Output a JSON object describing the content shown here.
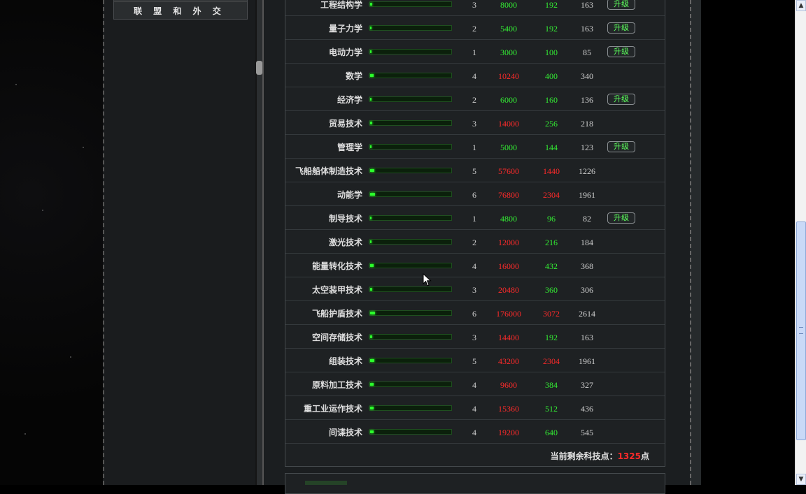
{
  "sidebar": {
    "items": [
      {
        "label": "联 盟 和 外 交"
      }
    ]
  },
  "tech_table": {
    "rows": [
      {
        "name": "工程结构学",
        "progress": 0.03,
        "level": "3",
        "cost": "8000",
        "cost_color": "green",
        "points": "192",
        "points_color": "green",
        "gain": "163",
        "upgrade": "升级"
      },
      {
        "name": "量子力学",
        "progress": 0.02,
        "level": "2",
        "cost": "5400",
        "cost_color": "green",
        "points": "192",
        "points_color": "green",
        "gain": "163",
        "upgrade": "升级"
      },
      {
        "name": "电动力学",
        "progress": 0.01,
        "level": "1",
        "cost": "3000",
        "cost_color": "green",
        "points": "100",
        "points_color": "green",
        "gain": "85",
        "upgrade": "升级"
      },
      {
        "name": "数学",
        "progress": 0.04,
        "level": "4",
        "cost": "10240",
        "cost_color": "red",
        "points": "400",
        "points_color": "green",
        "gain": "340",
        "upgrade": ""
      },
      {
        "name": "经济学",
        "progress": 0.02,
        "level": "2",
        "cost": "6000",
        "cost_color": "green",
        "points": "160",
        "points_color": "green",
        "gain": "136",
        "upgrade": "升级"
      },
      {
        "name": "贸易技术",
        "progress": 0.03,
        "level": "3",
        "cost": "14000",
        "cost_color": "red",
        "points": "256",
        "points_color": "green",
        "gain": "218",
        "upgrade": ""
      },
      {
        "name": "管理学",
        "progress": 0.01,
        "level": "1",
        "cost": "5000",
        "cost_color": "green",
        "points": "144",
        "points_color": "green",
        "gain": "123",
        "upgrade": "升级"
      },
      {
        "name": "飞船船体制造技术",
        "progress": 0.05,
        "level": "5",
        "cost": "57600",
        "cost_color": "red",
        "points": "1440",
        "points_color": "red",
        "gain": "1226",
        "upgrade": ""
      },
      {
        "name": "动能学",
        "progress": 0.06,
        "level": "6",
        "cost": "76800",
        "cost_color": "red",
        "points": "2304",
        "points_color": "red",
        "gain": "1961",
        "upgrade": ""
      },
      {
        "name": "制导技术",
        "progress": 0.01,
        "level": "1",
        "cost": "4800",
        "cost_color": "green",
        "points": "96",
        "points_color": "green",
        "gain": "82",
        "upgrade": "升级"
      },
      {
        "name": "激光技术",
        "progress": 0.02,
        "level": "2",
        "cost": "12000",
        "cost_color": "red",
        "points": "216",
        "points_color": "green",
        "gain": "184",
        "upgrade": ""
      },
      {
        "name": "能量转化技术",
        "progress": 0.04,
        "level": "4",
        "cost": "16000",
        "cost_color": "red",
        "points": "432",
        "points_color": "green",
        "gain": "368",
        "upgrade": ""
      },
      {
        "name": "太空装甲技术",
        "progress": 0.03,
        "level": "3",
        "cost": "20480",
        "cost_color": "red",
        "points": "360",
        "points_color": "green",
        "gain": "306",
        "upgrade": ""
      },
      {
        "name": "飞船护盾技术",
        "progress": 0.06,
        "level": "6",
        "cost": "176000",
        "cost_color": "red",
        "points": "3072",
        "points_color": "red",
        "gain": "2614",
        "upgrade": ""
      },
      {
        "name": "空间存储技术",
        "progress": 0.03,
        "level": "3",
        "cost": "14400",
        "cost_color": "red",
        "points": "192",
        "points_color": "green",
        "gain": "163",
        "upgrade": ""
      },
      {
        "name": "组装技术",
        "progress": 0.05,
        "level": "5",
        "cost": "43200",
        "cost_color": "red",
        "points": "2304",
        "points_color": "red",
        "gain": "1961",
        "upgrade": ""
      },
      {
        "name": "原料加工技术",
        "progress": 0.04,
        "level": "4",
        "cost": "9600",
        "cost_color": "red",
        "points": "384",
        "points_color": "green",
        "gain": "327",
        "upgrade": ""
      },
      {
        "name": "重工业运作技术",
        "progress": 0.04,
        "level": "4",
        "cost": "15360",
        "cost_color": "red",
        "points": "512",
        "points_color": "green",
        "gain": "436",
        "upgrade": ""
      },
      {
        "name": "间谍技术",
        "progress": 0.04,
        "level": "4",
        "cost": "19200",
        "cost_color": "red",
        "points": "640",
        "points_color": "green",
        "gain": "545",
        "upgrade": ""
      }
    ],
    "footer_prefix": "当前剩余科技点：",
    "remaining_points": "1325",
    "footer_suffix": "点"
  },
  "colors": {
    "red": "#ff2a2a",
    "green": "#33ee33",
    "bar": "#2cff2c"
  },
  "scrollbar": {
    "up_icon": "up-arrow-icon",
    "down_icon": "down-arrow-icon"
  }
}
